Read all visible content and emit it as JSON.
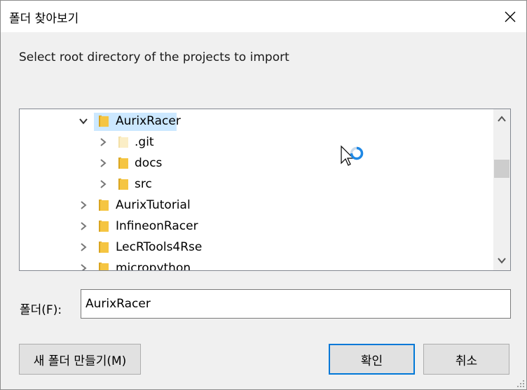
{
  "dialog": {
    "title": "폴더 찾아보기",
    "instruction": "Select root directory of the projects to import"
  },
  "tree": {
    "items": [
      {
        "label": "AurixRacer",
        "expanded": true,
        "selected": true
      },
      {
        "label": ".git",
        "expanded": false
      },
      {
        "label": "docs",
        "expanded": false
      },
      {
        "label": "src",
        "expanded": false
      },
      {
        "label": "AurixTutorial",
        "expanded": false
      },
      {
        "label": "InfineonRacer",
        "expanded": false
      },
      {
        "label": "LecRTools4Rse",
        "expanded": false
      },
      {
        "label": "micropython",
        "expanded": false
      }
    ]
  },
  "folder_field": {
    "label": "폴더(F):",
    "value": "AurixRacer"
  },
  "buttons": {
    "new_folder": "새 폴더 만들기(M)",
    "ok": "확인",
    "cancel": "취소"
  },
  "colors": {
    "selection": "#cce8ff",
    "default_button_border": "#0078d7",
    "folder_yellow": "#f0c040"
  }
}
